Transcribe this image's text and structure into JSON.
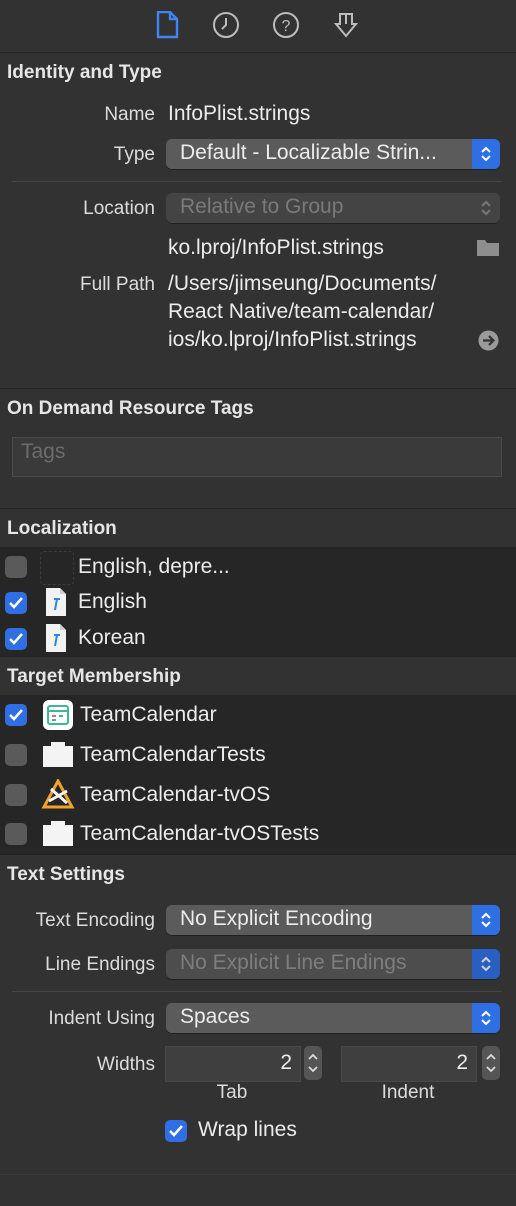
{
  "toolbar": {
    "icons": [
      "file-inspector-icon",
      "history-icon",
      "help-icon",
      "identity-icon"
    ]
  },
  "identity": {
    "title": "Identity and Type",
    "name_label": "Name",
    "name_value": "InfoPlist.strings",
    "type_label": "Type",
    "type_value": "Default - Localizable Strin...",
    "location_label": "Location",
    "location_value": "Relative to Group",
    "location_path": "ko.lproj/InfoPlist.strings",
    "fullpath_label": "Full Path",
    "fullpath_lines": [
      "/Users/jimseung/Documents/",
      "React Native/team-calendar/",
      "ios/ko.lproj/InfoPlist.strings"
    ]
  },
  "on_demand": {
    "title": "On Demand Resource Tags",
    "tags_placeholder": "Tags"
  },
  "localization": {
    "title": "Localization",
    "items": [
      {
        "label": "English, depre...",
        "checked": false
      },
      {
        "label": "English",
        "checked": true
      },
      {
        "label": "Korean",
        "checked": true
      }
    ]
  },
  "target_membership": {
    "title": "Target Membership",
    "items": [
      {
        "label": "TeamCalendar",
        "checked": true,
        "icon": "calendar-app-icon"
      },
      {
        "label": "TeamCalendarTests",
        "checked": false,
        "icon": "test-bundle-icon"
      },
      {
        "label": "TeamCalendar-tvOS",
        "checked": false,
        "icon": "tvos-app-icon"
      },
      {
        "label": "TeamCalendar-tvOSTests",
        "checked": false,
        "icon": "test-bundle-icon"
      }
    ]
  },
  "text_settings": {
    "title": "Text Settings",
    "encoding_label": "Text Encoding",
    "encoding_value": "No Explicit Encoding",
    "line_endings_label": "Line Endings",
    "line_endings_value": "No Explicit Line Endings",
    "indent_label": "Indent Using",
    "indent_value": "Spaces",
    "widths_label": "Widths",
    "tab_width": "2",
    "tab_caption": "Tab",
    "indent_width": "2",
    "indent_caption": "Indent",
    "wrap_label": "Wrap lines",
    "wrap_checked": true
  },
  "colors": {
    "accent": "#2f6fe4",
    "background": "#323232",
    "band": "#262626"
  }
}
